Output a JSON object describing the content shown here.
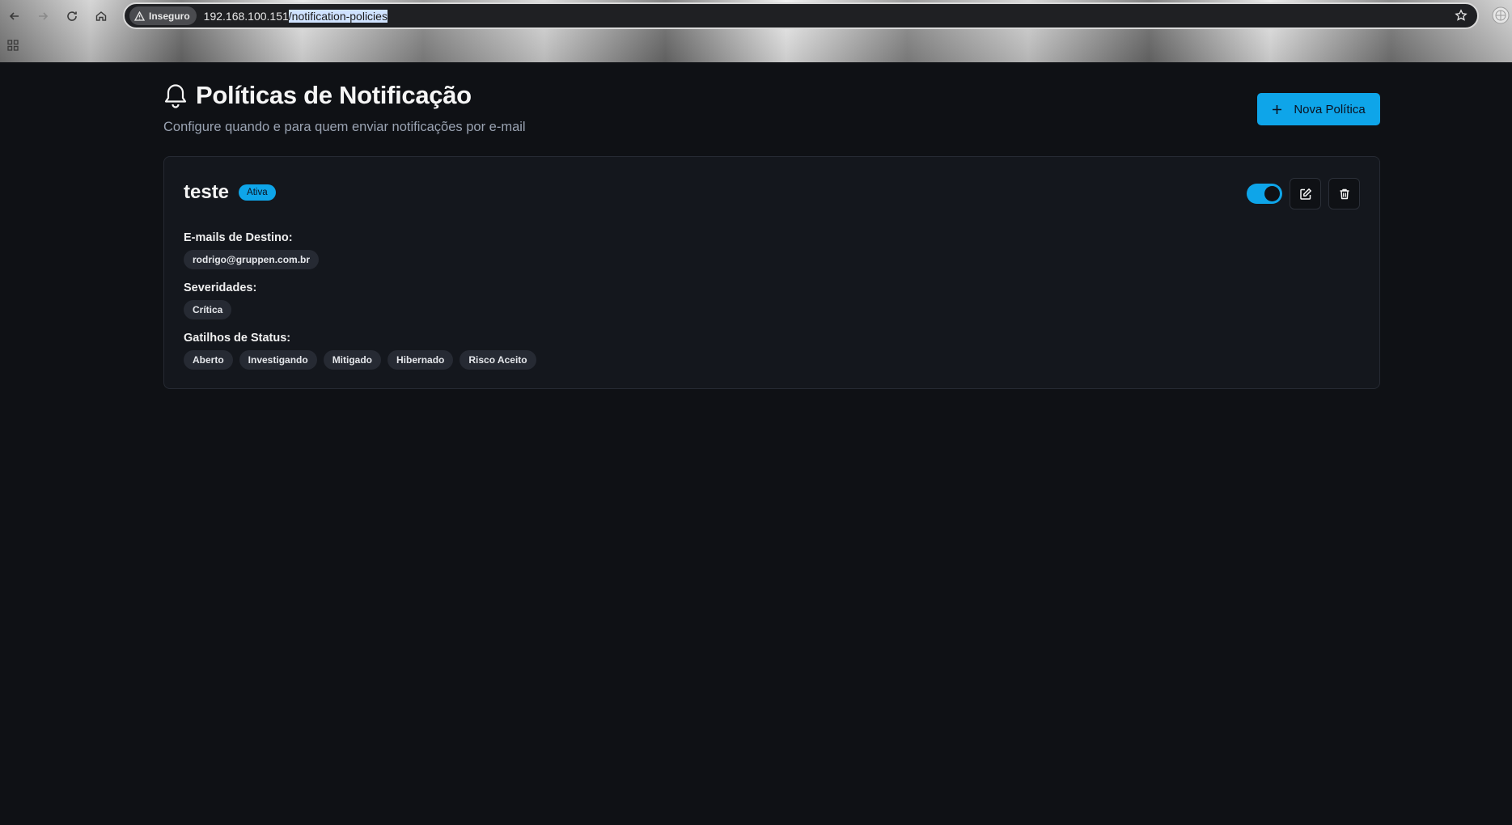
{
  "browser": {
    "insecure_label": "Inseguro",
    "url_host": "192.168.100.151",
    "url_path": "/notification-policies"
  },
  "page": {
    "title": "Políticas de Notificação",
    "subtitle": "Configure quando e para quem enviar notificações por e-mail",
    "new_button_label": "Nova Política"
  },
  "policy": {
    "name": "teste",
    "status_badge": "Ativa",
    "enabled": true,
    "emails_label": "E-mails de Destino:",
    "emails": [
      "rodrigo@gruppen.com.br"
    ],
    "severities_label": "Severidades:",
    "severities": [
      "Crítica"
    ],
    "triggers_label": "Gatilhos de Status:",
    "triggers": [
      "Aberto",
      "Investigando",
      "Mitigado",
      "Hibernado",
      "Risco Aceito"
    ]
  },
  "colors": {
    "accent": "#0ea5e9",
    "background": "#0f1115",
    "card": "#14171d"
  },
  "icons": [
    "back-arrow-icon",
    "forward-arrow-icon",
    "reload-icon",
    "home-icon",
    "warning-icon",
    "star-icon",
    "apps-grid-icon",
    "profile-icon",
    "bell-icon",
    "plus-icon",
    "edit-icon",
    "trash-icon"
  ]
}
